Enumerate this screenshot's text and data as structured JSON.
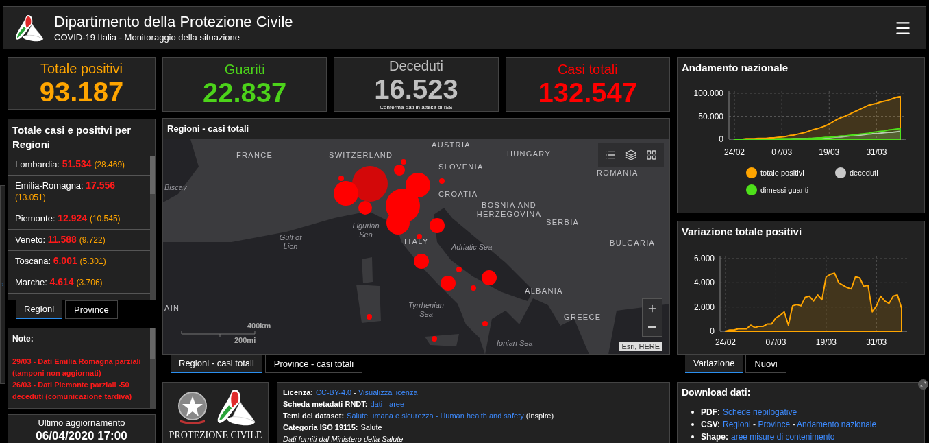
{
  "header": {
    "title": "Dipartimento della Protezione Civile",
    "subtitle": "COVID-19 Italia - Monitoraggio della situazione"
  },
  "stat_cards": [
    {
      "label": "Totale positivi",
      "value": "93.187",
      "color": "#ffa500"
    },
    {
      "label": "Guariti",
      "value": "22.837",
      "color": "#4cd31a"
    },
    {
      "label": "Deceduti",
      "value": "16.523",
      "color": "#c0c0c0",
      "note": "Conferma dati in attesa di ISS"
    },
    {
      "label": "Casi totali",
      "value": "132.547",
      "color": "#ff0000"
    }
  ],
  "regions_panel": {
    "title": "Totale casi e positivi per Regioni",
    "items": [
      {
        "name": "Lombardia:",
        "total": "51.534",
        "positives": "(28.469)"
      },
      {
        "name": "Emilia-Romagna:",
        "total": "17.556",
        "positives": "(13.051)"
      },
      {
        "name": "Piemonte:",
        "total": "12.924",
        "positives": "(10.545)"
      },
      {
        "name": "Veneto:",
        "total": "11.588",
        "positives": "(9.722)"
      },
      {
        "name": "Toscana:",
        "total": "6.001",
        "positives": "(5.301)"
      },
      {
        "name": "Marche:",
        "total": "4.614",
        "positives": "(3.706)"
      }
    ]
  },
  "region_tabs": [
    {
      "label": "Regioni",
      "selected": true
    },
    {
      "label": "Province",
      "selected": false
    }
  ],
  "notes": {
    "title": "Note:",
    "items": [
      "29/03 - Dati  Emilia Romagna parziali (tamponi non aggiornati)",
      "26/03 - Dati Piemonte parziali -50 deceduti (comunicazione tardiva)"
    ]
  },
  "last_update": {
    "label": "Ultimo aggiornamento",
    "value": "06/04/2020 17:00"
  },
  "map": {
    "title": "Regioni - casi totali",
    "labels": [
      {
        "text": "FRANCE",
        "kind": "country"
      },
      {
        "text": "SWITZERLAND",
        "kind": "country"
      },
      {
        "text": "AUSTRIA",
        "kind": "country"
      },
      {
        "text": "HUNGARY",
        "kind": "country"
      },
      {
        "text": "SLOVENIA",
        "kind": "country"
      },
      {
        "text": "ROMANIA",
        "kind": "country"
      },
      {
        "text": "Biscay",
        "kind": "sea"
      },
      {
        "text": "CROATIA",
        "kind": "country"
      },
      {
        "text": "BOSNIA AND HERZEGOVINA",
        "kind": "country"
      },
      {
        "text": "SERBIA",
        "kind": "country"
      },
      {
        "text": "Ligurian Sea",
        "kind": "sea"
      },
      {
        "text": "Gulf of Lion",
        "kind": "sea"
      },
      {
        "text": "ITALY",
        "kind": "country"
      },
      {
        "text": "Adriatic Sea",
        "kind": "sea"
      },
      {
        "text": "BULGARIA",
        "kind": "country"
      },
      {
        "text": "ALBANIA",
        "kind": "country"
      },
      {
        "text": "AIN",
        "kind": "country"
      },
      {
        "text": "Tyrrhenian Sea",
        "kind": "sea"
      },
      {
        "text": "GREECE",
        "kind": "country"
      },
      {
        "text": "Ionian Sea",
        "kind": "sea"
      }
    ],
    "scale": [
      "400km",
      "200mi"
    ],
    "attribution": "Esri, HERE"
  },
  "map_tabs": [
    {
      "label": "Regioni - casi totali",
      "selected": true
    },
    {
      "label": "Province - casi totali",
      "selected": false
    }
  ],
  "logo_box": {
    "caption": "PROTEZIONE CIVILE"
  },
  "info": [
    {
      "label": "Licenza:",
      "parts": [
        {
          "text": "CC-BY-4.0",
          "kind": "link"
        },
        {
          "text": " - ",
          "kind": "text"
        },
        {
          "text": "Visualizza licenza",
          "kind": "link"
        }
      ]
    },
    {
      "label": "Scheda metadati RNDT:",
      "parts": [
        {
          "text": "dati",
          "kind": "link"
        },
        {
          "text": " - ",
          "kind": "text"
        },
        {
          "text": "aree",
          "kind": "link"
        }
      ]
    },
    {
      "label": "Temi del dataset:",
      "parts": [
        {
          "text": "Salute umana e sicurezza - Human health and safety",
          "kind": "link"
        },
        {
          "text": " (Inspire)",
          "kind": "text"
        }
      ]
    },
    {
      "label": "Categoria ISO 19115:",
      "parts": [
        {
          "text": "Salute",
          "kind": "text"
        }
      ]
    },
    {
      "parts": [
        {
          "text": "Dati forniti dal Ministero della Salute",
          "kind": "italic"
        }
      ]
    }
  ],
  "trend_panel": {
    "title": "Andamento nazionale",
    "chart_data": {
      "type": "area",
      "categories": [
        "24/02",
        null,
        null,
        null,
        null,
        null,
        null,
        null,
        null,
        null,
        null,
        null,
        "07/03",
        null,
        null,
        null,
        null,
        null,
        null,
        null,
        null,
        null,
        null,
        null,
        "19/03",
        null,
        null,
        null,
        null,
        null,
        null,
        null,
        null,
        null,
        null,
        null,
        "31/03",
        null,
        null,
        null,
        null,
        null,
        null
      ],
      "series": [
        {
          "name": "totale positivi",
          "color": "#ffa500",
          "values": [
            0,
            0,
            0,
            1,
            1,
            1,
            2,
            2,
            2,
            3,
            3,
            4,
            5,
            6,
            8,
            9,
            11,
            13,
            15,
            18,
            21,
            23,
            26,
            29,
            33,
            38,
            43,
            47,
            50,
            54,
            58,
            62,
            66,
            70,
            74,
            76,
            78,
            81,
            83,
            85,
            88,
            91,
            93
          ]
        },
        {
          "name": "deceduti",
          "color": "#c8c8c8",
          "values": [
            0,
            0,
            0,
            0,
            0,
            0,
            0,
            0,
            0,
            0,
            0,
            0,
            0,
            0,
            0,
            1,
            1,
            1,
            1,
            1,
            2,
            2,
            3,
            3,
            3,
            4,
            5,
            5,
            6,
            7,
            8,
            8,
            9,
            10,
            11,
            12,
            12,
            13,
            14,
            15,
            15,
            16,
            17
          ]
        },
        {
          "name": "dimessi guariti",
          "color": "#4ee01a",
          "values": [
            0,
            0,
            0,
            0,
            0,
            0,
            0,
            0,
            0,
            0,
            0,
            1,
            1,
            1,
            1,
            1,
            1,
            1,
            1,
            2,
            2,
            3,
            3,
            4,
            4,
            5,
            6,
            7,
            7,
            8,
            9,
            10,
            11,
            12,
            13,
            15,
            16,
            17,
            18,
            20,
            21,
            22,
            23
          ]
        }
      ],
      "grid": true,
      "ylim": [
        0,
        100
      ],
      "yticks": [
        {
          "value": 0,
          "label": "0"
        },
        {
          "value": 50,
          "label": "50.000"
        },
        {
          "value": 100,
          "label": "100.000"
        }
      ]
    }
  },
  "variation_panel": {
    "title": "Variazione totale positivi",
    "chart_data": {
      "type": "area",
      "categories": [
        "24/02",
        null,
        null,
        null,
        null,
        null,
        null,
        null,
        null,
        null,
        null,
        null,
        "07/03",
        null,
        null,
        null,
        null,
        null,
        null,
        null,
        null,
        null,
        null,
        null,
        "19/03",
        null,
        null,
        null,
        null,
        null,
        null,
        null,
        null,
        null,
        null,
        null,
        "31/03",
        null,
        null,
        null,
        null,
        null,
        null
      ],
      "series": [
        {
          "color": "#ffa500",
          "values": [
            0,
            0.1,
            0.1,
            0.2,
            0.2,
            0.2,
            0.5,
            0.3,
            0.4,
            0.4,
            0.6,
            0.6,
            1.1,
            1.3,
            1.6,
            0.5,
            2.1,
            2.2,
            2.1,
            2.8,
            2.9,
            2.5,
            3,
            2.6,
            4.5,
            4.7,
            4.8,
            4,
            3.8,
            3.6,
            3.5,
            4.5,
            4.4,
            3.7,
            3.8,
            1.6,
            2.1,
            2.9,
            2.5,
            2.3,
            2.9,
            3,
            1.9
          ]
        }
      ],
      "grid": true,
      "ylim": [
        0,
        6
      ],
      "yticks": [
        {
          "value": 0,
          "label": "0"
        },
        {
          "value": 2,
          "label": "2.000"
        },
        {
          "value": 4,
          "label": "4.000"
        },
        {
          "value": 6,
          "label": "6.000"
        }
      ]
    }
  },
  "chart_tabs": [
    {
      "label": "Variazione",
      "selected": true
    },
    {
      "label": "Nuovi",
      "selected": false
    }
  ],
  "download": {
    "title": "Download dati:",
    "items": [
      {
        "label": "PDF:",
        "parts": [
          {
            "text": "Schede riepilogative",
            "kind": "link"
          }
        ]
      },
      {
        "label": "CSV:",
        "parts": [
          {
            "text": "Regioni",
            "kind": "link"
          },
          {
            "text": " - ",
            "kind": "text"
          },
          {
            "text": "Province",
            "kind": "link"
          },
          {
            "text": " - ",
            "kind": "text"
          },
          {
            "text": "Andamento nazionale",
            "kind": "link"
          }
        ]
      },
      {
        "label": "Shape:",
        "parts": [
          {
            "text": "aree misure di contenimento",
            "kind": "link"
          }
        ]
      }
    ]
  }
}
